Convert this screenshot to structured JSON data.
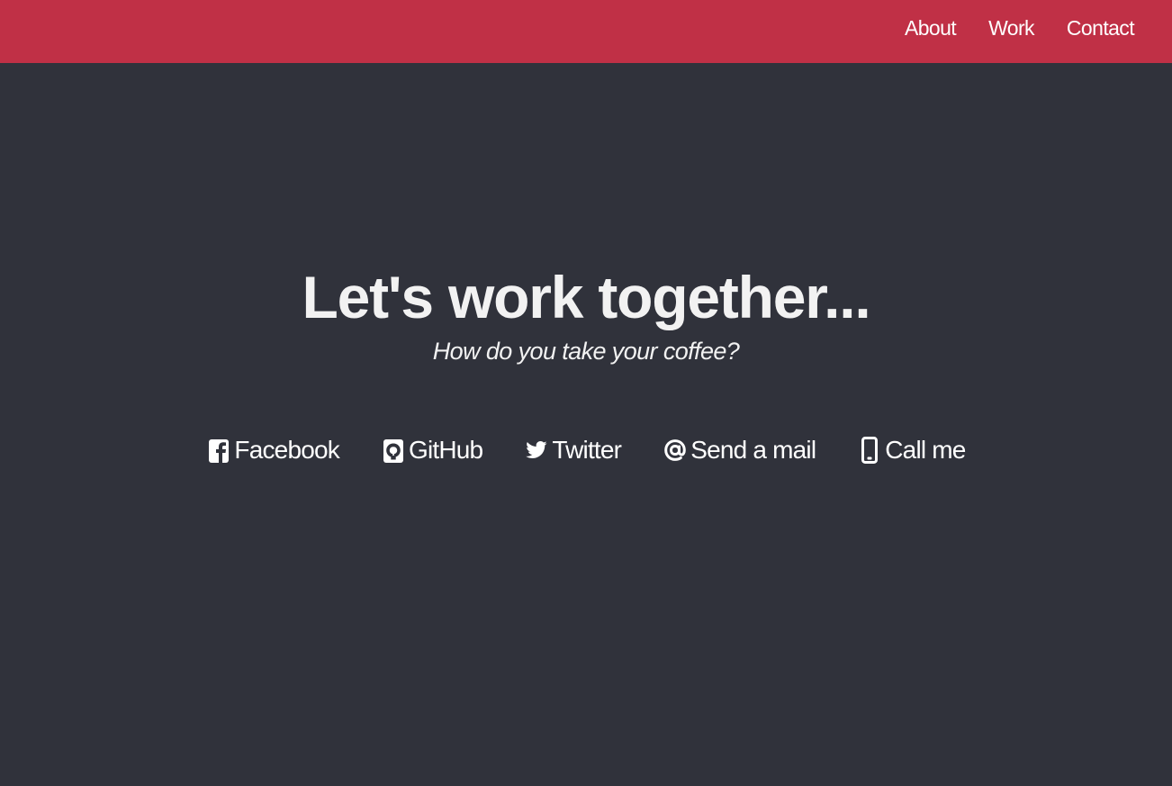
{
  "nav": {
    "items": [
      {
        "label": "About"
      },
      {
        "label": "Work"
      },
      {
        "label": "Contact"
      }
    ]
  },
  "hero": {
    "title": "Let's work together...",
    "subtitle": "How do you take your coffee?"
  },
  "contact_links": [
    {
      "icon": "facebook-square-icon",
      "label": "Facebook"
    },
    {
      "icon": "github-square-icon",
      "label": "GitHub"
    },
    {
      "icon": "twitter-bird-icon",
      "label": "Twitter"
    },
    {
      "icon": "at-sign-icon",
      "label": "Send a mail"
    },
    {
      "icon": "mobile-phone-icon",
      "label": "Call me"
    }
  ],
  "colors": {
    "header_bg": "#c03046",
    "page_bg": "#30323b",
    "text": "#f2f2f2"
  }
}
